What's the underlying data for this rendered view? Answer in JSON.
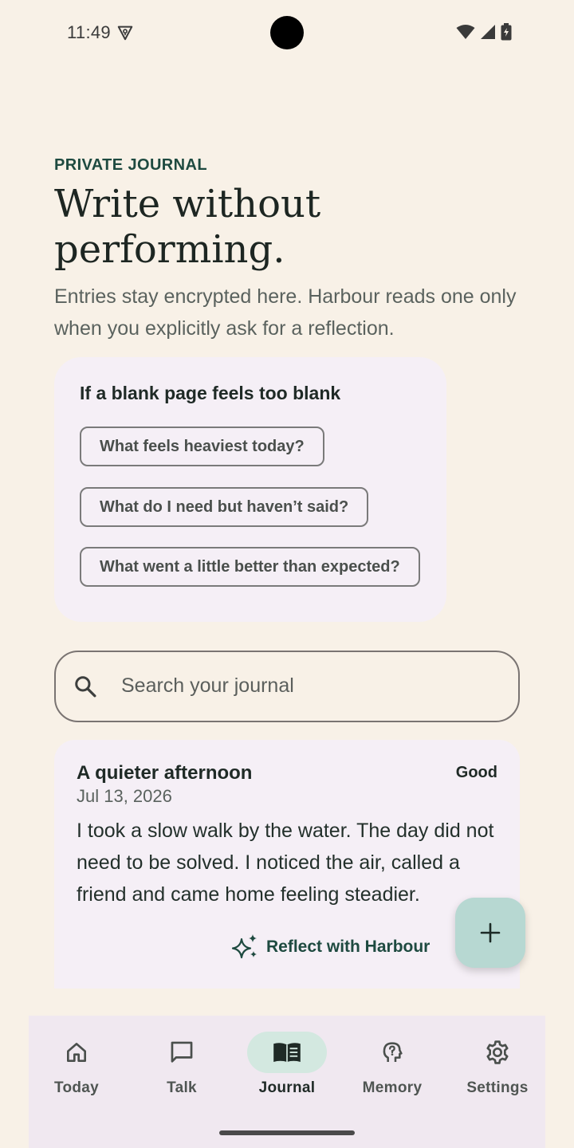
{
  "status_bar": {
    "time": "11:49"
  },
  "header": {
    "eyebrow": "PRIVATE JOURNAL",
    "headline": "Write without performing.",
    "subtitle": "Entries stay encrypted here. Harbour reads one only when you explicitly ask for a reflection."
  },
  "prompts": {
    "title": "If a blank page feels too blank",
    "chips": [
      "What feels heaviest today?",
      "What do I need but haven’t said?",
      "What went a little better than expected?"
    ]
  },
  "search": {
    "placeholder": "Search your journal"
  },
  "entry": {
    "title": "A quieter afternoon",
    "mood": "Good",
    "date": "Jul 13, 2026",
    "body": "I took a slow walk by the water. The day did not need to be solved. I noticed the air, called a friend and came home feeling steadier.",
    "reflect_label": "Reflect with Harbour"
  },
  "fab": {
    "icon": "plus-icon"
  },
  "nav": {
    "items": [
      {
        "label": "Today",
        "icon": "home-icon"
      },
      {
        "label": "Talk",
        "icon": "chat-bubble-icon"
      },
      {
        "label": "Journal",
        "icon": "book-icon"
      },
      {
        "label": "Memory",
        "icon": "head-question-icon"
      },
      {
        "label": "Settings",
        "icon": "gear-icon"
      }
    ],
    "active": "Journal"
  },
  "colors": {
    "background": "#f8f1e7",
    "accent": "#1e4a40",
    "card": "#f5eff6",
    "fab": "#b7d8d2",
    "nav_active_pill": "#d3e8e0"
  }
}
